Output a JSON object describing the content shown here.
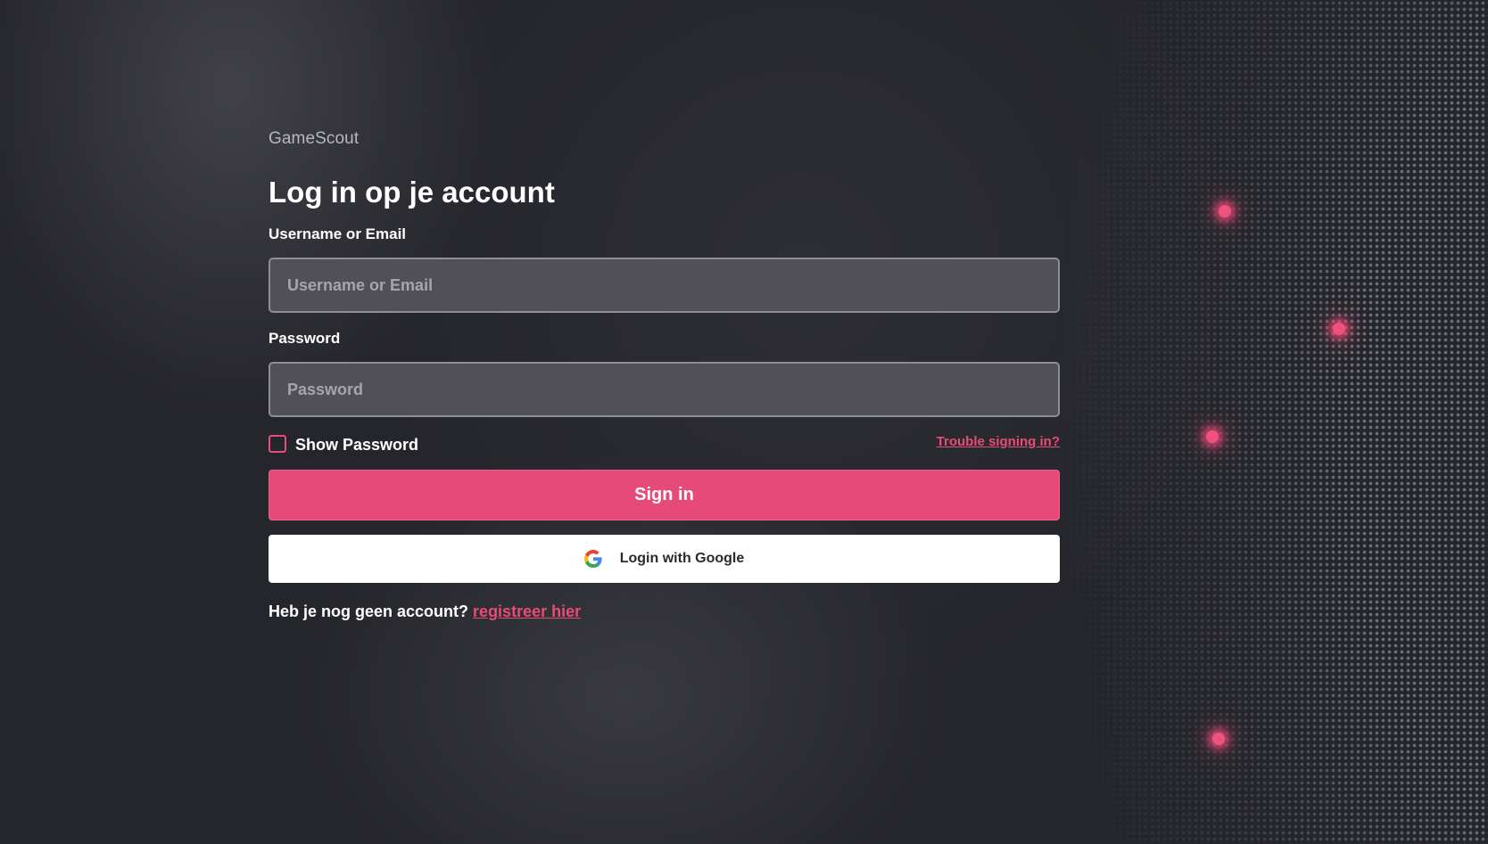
{
  "brand": {
    "name": "GameScout"
  },
  "login": {
    "title": "Log in op je account",
    "username_label": "Username or Email",
    "username_placeholder": "Username or Email",
    "username_value": "",
    "password_label": "Password",
    "password_placeholder": "Password",
    "password_value": "",
    "show_password_label": "Show Password",
    "show_password_checked": false,
    "trouble_link": "Trouble signing in?",
    "signin_label": "Sign in",
    "google_label": "Login with Google",
    "google_icon": "google-icon",
    "register_prompt": "Heb je nog geen account?",
    "register_link": "registreer hier"
  },
  "colors": {
    "accent": "#e64a78",
    "background": "#25262b",
    "input_background": "#505056",
    "input_border": "#8e8e96",
    "google_button_background": "#ffffff"
  }
}
